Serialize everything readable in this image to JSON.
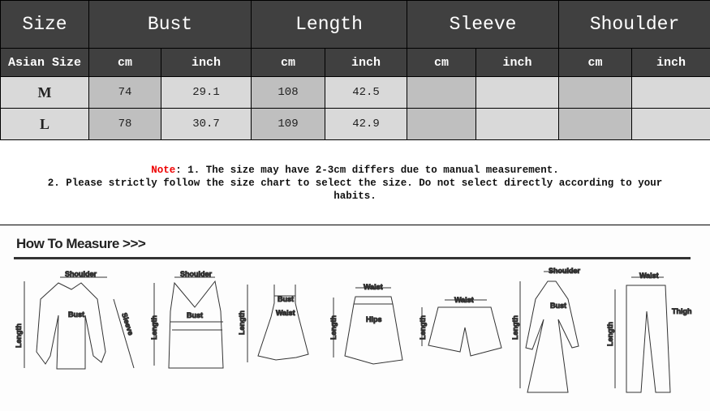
{
  "table": {
    "headers": [
      "Size",
      "Bust",
      "Length",
      "Sleeve",
      "Shoulder"
    ],
    "subheaders": [
      "Asian Size",
      "cm",
      "inch",
      "cm",
      "inch",
      "cm",
      "inch",
      "cm",
      "inch"
    ],
    "rows": [
      {
        "size": "M",
        "bust_cm": "74",
        "bust_in": "29.1",
        "length_cm": "108",
        "length_in": "42.5",
        "sleeve_cm": "",
        "sleeve_in": "",
        "shoulder_cm": "",
        "shoulder_in": ""
      },
      {
        "size": "L",
        "bust_cm": "78",
        "bust_in": "30.7",
        "length_cm": "109",
        "length_in": "42.9",
        "sleeve_cm": "",
        "sleeve_in": "",
        "shoulder_cm": "",
        "shoulder_in": ""
      }
    ]
  },
  "note": {
    "label": "Note",
    "line1": ": 1. The size may have 2-3cm differs due to manual measurement.",
    "line2": "2. Please strictly follow the size chart to select the size. Do not select directly according to your habits.",
    "label_color": "#e00000"
  },
  "measure": {
    "title": "How To Measure >>>",
    "labels": {
      "shoulder": "Shoulder",
      "bust": "Bust",
      "sleeve": "Sleeve",
      "length": "Length",
      "waist": "Waist",
      "hips": "Hips",
      "thigh": "Thigh"
    }
  },
  "colors": {
    "header_bg": "#404040",
    "row_bg": "#d9d9d9",
    "cm_bg": "#bfbfbf"
  }
}
